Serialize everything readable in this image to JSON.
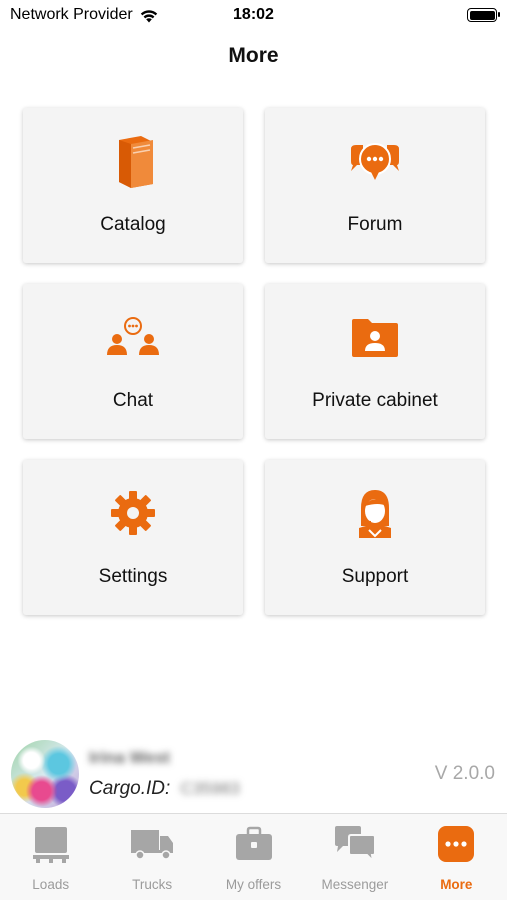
{
  "status_bar": {
    "carrier": "Network Provider",
    "time": "18:02",
    "battery_level": 1.0
  },
  "header": {
    "title": "More"
  },
  "colors": {
    "accent": "#ea6b10",
    "tile_bg": "#f4f4f4",
    "tab_inactive": "#9b9b9b"
  },
  "tiles": [
    {
      "label": "Catalog",
      "icon": "book-icon"
    },
    {
      "label": "Forum",
      "icon": "forum-icon"
    },
    {
      "label": "Chat",
      "icon": "chat-group-icon"
    },
    {
      "label": "Private cabinet",
      "icon": "user-folder-icon"
    },
    {
      "label": "Settings",
      "icon": "gear-icon"
    },
    {
      "label": "Support",
      "icon": "support-agent-icon"
    }
  ],
  "profile": {
    "name": "Irina West",
    "cargo_label": "Cargo.ID:",
    "cargo_id": "C35983",
    "version": "V 2.0.0"
  },
  "tabbar": {
    "active_index": 4,
    "tabs": [
      {
        "label": "Loads",
        "icon": "loads-icon"
      },
      {
        "label": "Trucks",
        "icon": "truck-icon"
      },
      {
        "label": "My offers",
        "icon": "briefcase-icon"
      },
      {
        "label": "Messenger",
        "icon": "messenger-icon"
      },
      {
        "label": "More",
        "icon": "more-icon"
      }
    ]
  }
}
